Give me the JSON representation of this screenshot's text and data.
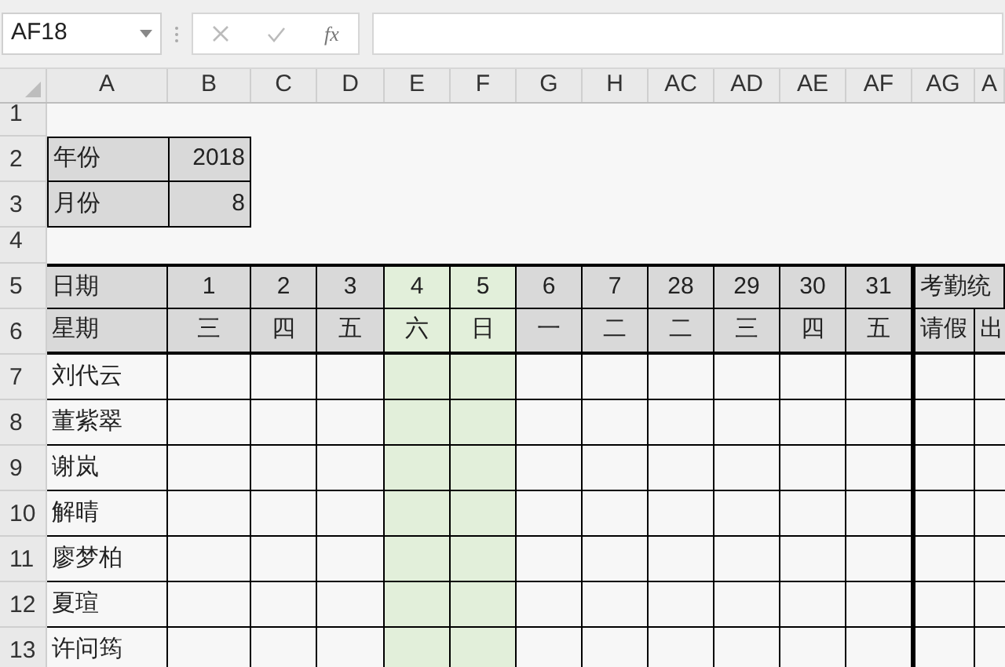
{
  "name_box": {
    "value": "AF18"
  },
  "formula_bar": {
    "function_label": "fx"
  },
  "columns": [
    "A",
    "B",
    "C",
    "D",
    "E",
    "F",
    "G",
    "H",
    "AC",
    "AD",
    "AE",
    "AF",
    "AG",
    "A"
  ],
  "rows": [
    "1",
    "2",
    "3",
    "4",
    "5",
    "6",
    "7",
    "8",
    "9",
    "10",
    "11",
    "12",
    "13"
  ],
  "info": [
    {
      "label": "年份",
      "value": "2018"
    },
    {
      "label": "月份",
      "value": "8"
    }
  ],
  "attendance": {
    "date_label": "日期",
    "weekday_label": "星期",
    "days": [
      {
        "date": "1",
        "weekday": "三",
        "weekend": false
      },
      {
        "date": "2",
        "weekday": "四",
        "weekend": false
      },
      {
        "date": "3",
        "weekday": "五",
        "weekend": false
      },
      {
        "date": "4",
        "weekday": "六",
        "weekend": true
      },
      {
        "date": "5",
        "weekday": "日",
        "weekend": true
      },
      {
        "date": "6",
        "weekday": "一",
        "weekend": false
      },
      {
        "date": "7",
        "weekday": "二",
        "weekend": false
      },
      {
        "date": "28",
        "weekday": "二",
        "weekend": false
      },
      {
        "date": "29",
        "weekday": "三",
        "weekend": false
      },
      {
        "date": "30",
        "weekday": "四",
        "weekend": false
      },
      {
        "date": "31",
        "weekday": "五",
        "weekend": false
      }
    ],
    "stats_title": "考勤统",
    "stats": [
      "请假",
      "出"
    ],
    "employees": [
      "刘代云",
      "董紫翠",
      "谢岚",
      "解晴",
      "廖梦柏",
      "夏瑄",
      "许问筠"
    ]
  }
}
